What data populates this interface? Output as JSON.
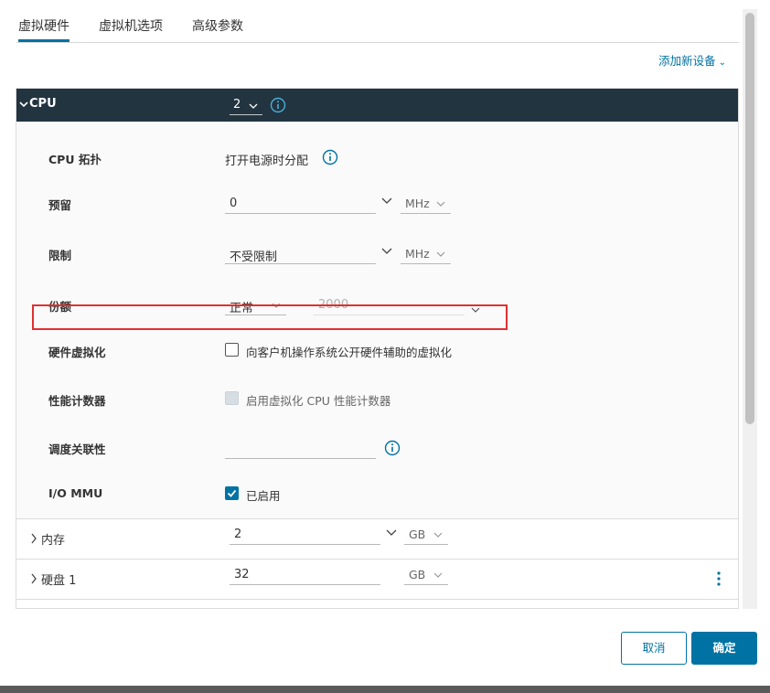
{
  "tabs": [
    {
      "label": "虚拟硬件",
      "active": true
    },
    {
      "label": "虚拟机选项",
      "active": false
    },
    {
      "label": "高级参数",
      "active": false
    }
  ],
  "add_device": {
    "label": "添加新设备",
    "chevron": "chevron-down-icon"
  },
  "cpu": {
    "header_label": "CPU",
    "count_value": "2",
    "topology": {
      "label": "CPU 拓扑",
      "value": "打开电源时分配"
    },
    "reservation": {
      "label": "预留",
      "value": "0",
      "unit": "MHz"
    },
    "limit": {
      "label": "限制",
      "value": "不受限制",
      "unit": "MHz"
    },
    "shares": {
      "label": "份额",
      "level": "正常",
      "value": "2000"
    },
    "hw_virt": {
      "label": "硬件虚拟化",
      "checkbox_label": "向客户机操作系统公开硬件辅助的虚拟化",
      "checked": false
    },
    "perf_counters": {
      "label": "性能计数器",
      "checkbox_label": "启用虚拟化 CPU 性能计数器",
      "checked": false,
      "disabled": true
    },
    "sched_affinity": {
      "label": "调度关联性",
      "value": ""
    },
    "io_mmu": {
      "label": "I/O MMU",
      "checkbox_label": "已启用",
      "checked": true
    }
  },
  "memory": {
    "label": "内存",
    "value": "2",
    "unit": "GB"
  },
  "disk": {
    "label": "硬盘 1",
    "value": "32",
    "unit": "GB"
  },
  "footer": {
    "cancel_label": "取消",
    "ok_label": "确定"
  },
  "colors": {
    "accent": "#0072a3",
    "header_bg": "#223440",
    "highlight": "#e03030"
  }
}
